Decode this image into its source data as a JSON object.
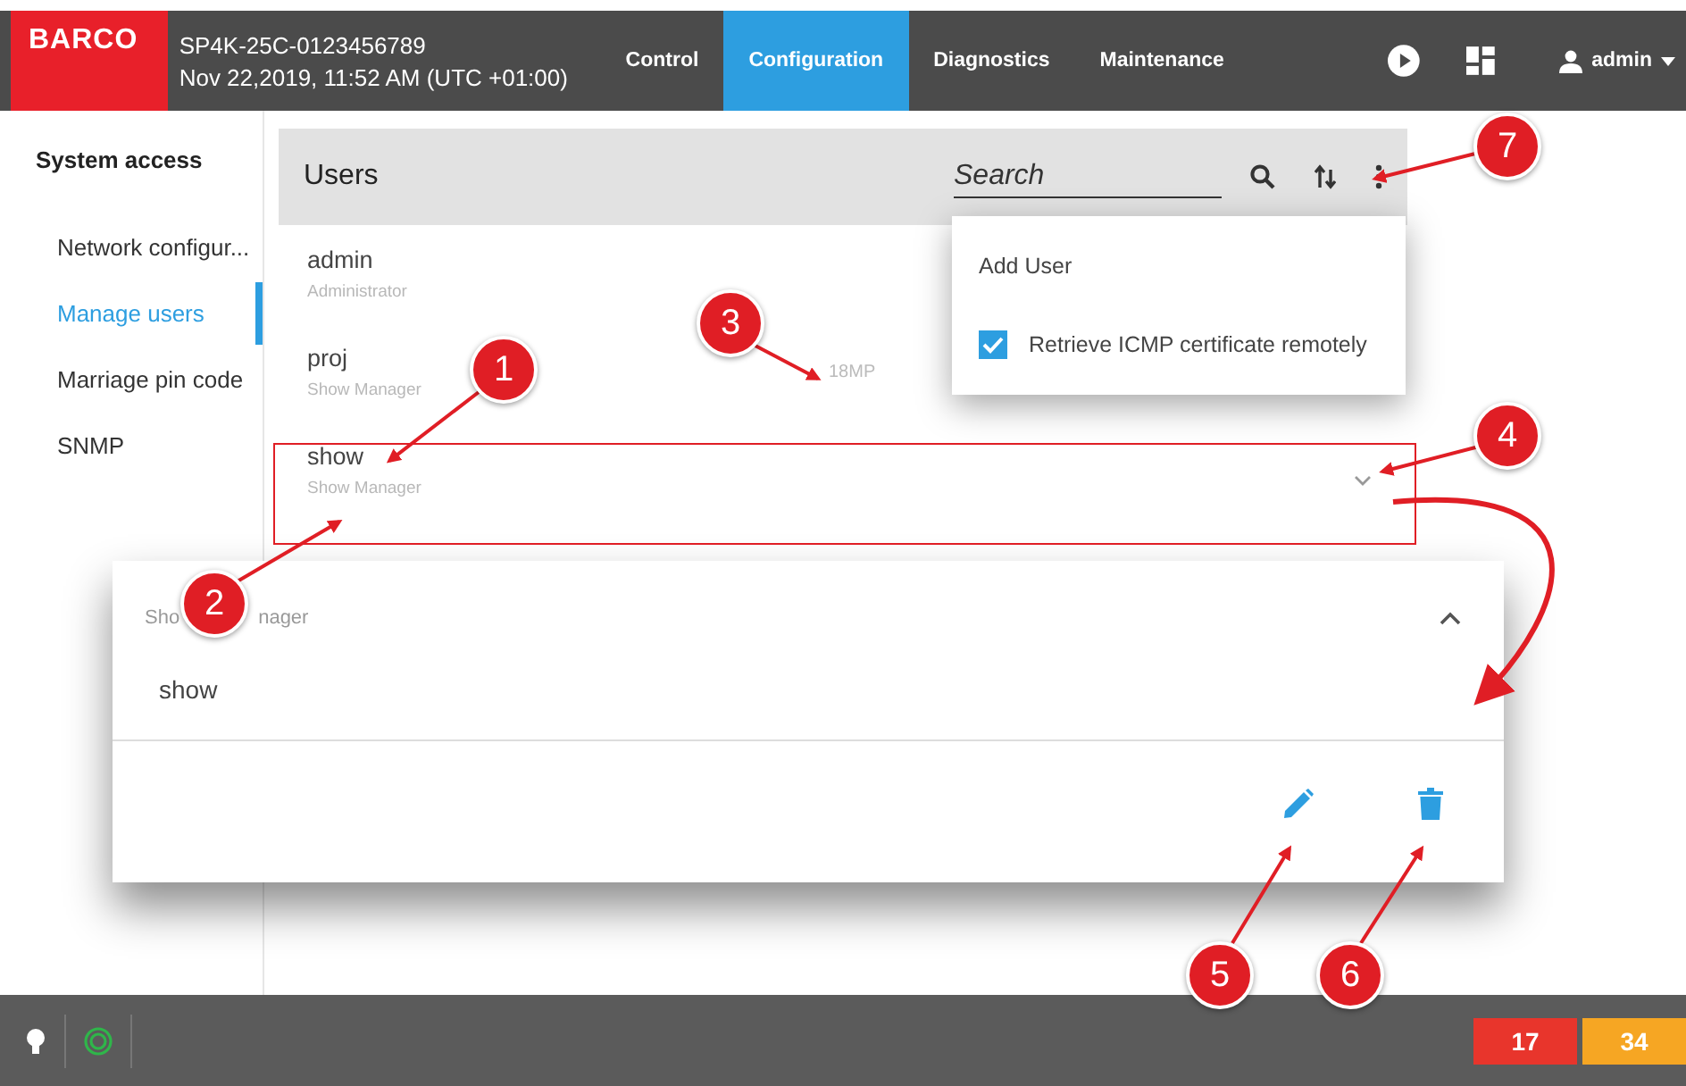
{
  "header": {
    "logo": "BARCO",
    "device": "SP4K-25C-0123456789",
    "datetime": "Nov 22,2019, 11:52 AM (UTC +01:00)",
    "tabs": [
      {
        "label": "Control",
        "selected": false
      },
      {
        "label": "Configuration",
        "selected": true
      },
      {
        "label": "Diagnostics",
        "selected": false
      },
      {
        "label": "Maintenance",
        "selected": false
      }
    ],
    "user": "admin"
  },
  "sidebar": {
    "title": "System access",
    "items": [
      {
        "label": "Network configur...",
        "selected": false
      },
      {
        "label": "Manage users",
        "selected": true
      },
      {
        "label": "Marriage pin code",
        "selected": false
      },
      {
        "label": "SNMP",
        "selected": false
      }
    ]
  },
  "users": {
    "title": "Users",
    "search": {
      "placeholder": "Search"
    },
    "rows": [
      {
        "name": "admin",
        "role": "Administrator"
      },
      {
        "name": "proj",
        "role": "Show Manager",
        "column_3": "18MP"
      },
      {
        "name": "show",
        "role": "Show Manager"
      }
    ]
  },
  "menu": {
    "items": [
      {
        "kind": "action",
        "label": "Add User"
      },
      {
        "kind": "checkbox",
        "label": "Retrieve ICMP certificate remotely",
        "checked": true
      }
    ]
  },
  "detail": {
    "role_visible": [
      "Sho",
      "nager"
    ],
    "name": "show",
    "expanded": true
  },
  "callouts": [
    "1",
    "2",
    "3",
    "4",
    "5",
    "6",
    "7"
  ],
  "status_bar": {
    "alerts": [
      {
        "count": "17",
        "color": "#e8352c"
      },
      {
        "count": "34",
        "color": "#f6a623"
      }
    ]
  }
}
